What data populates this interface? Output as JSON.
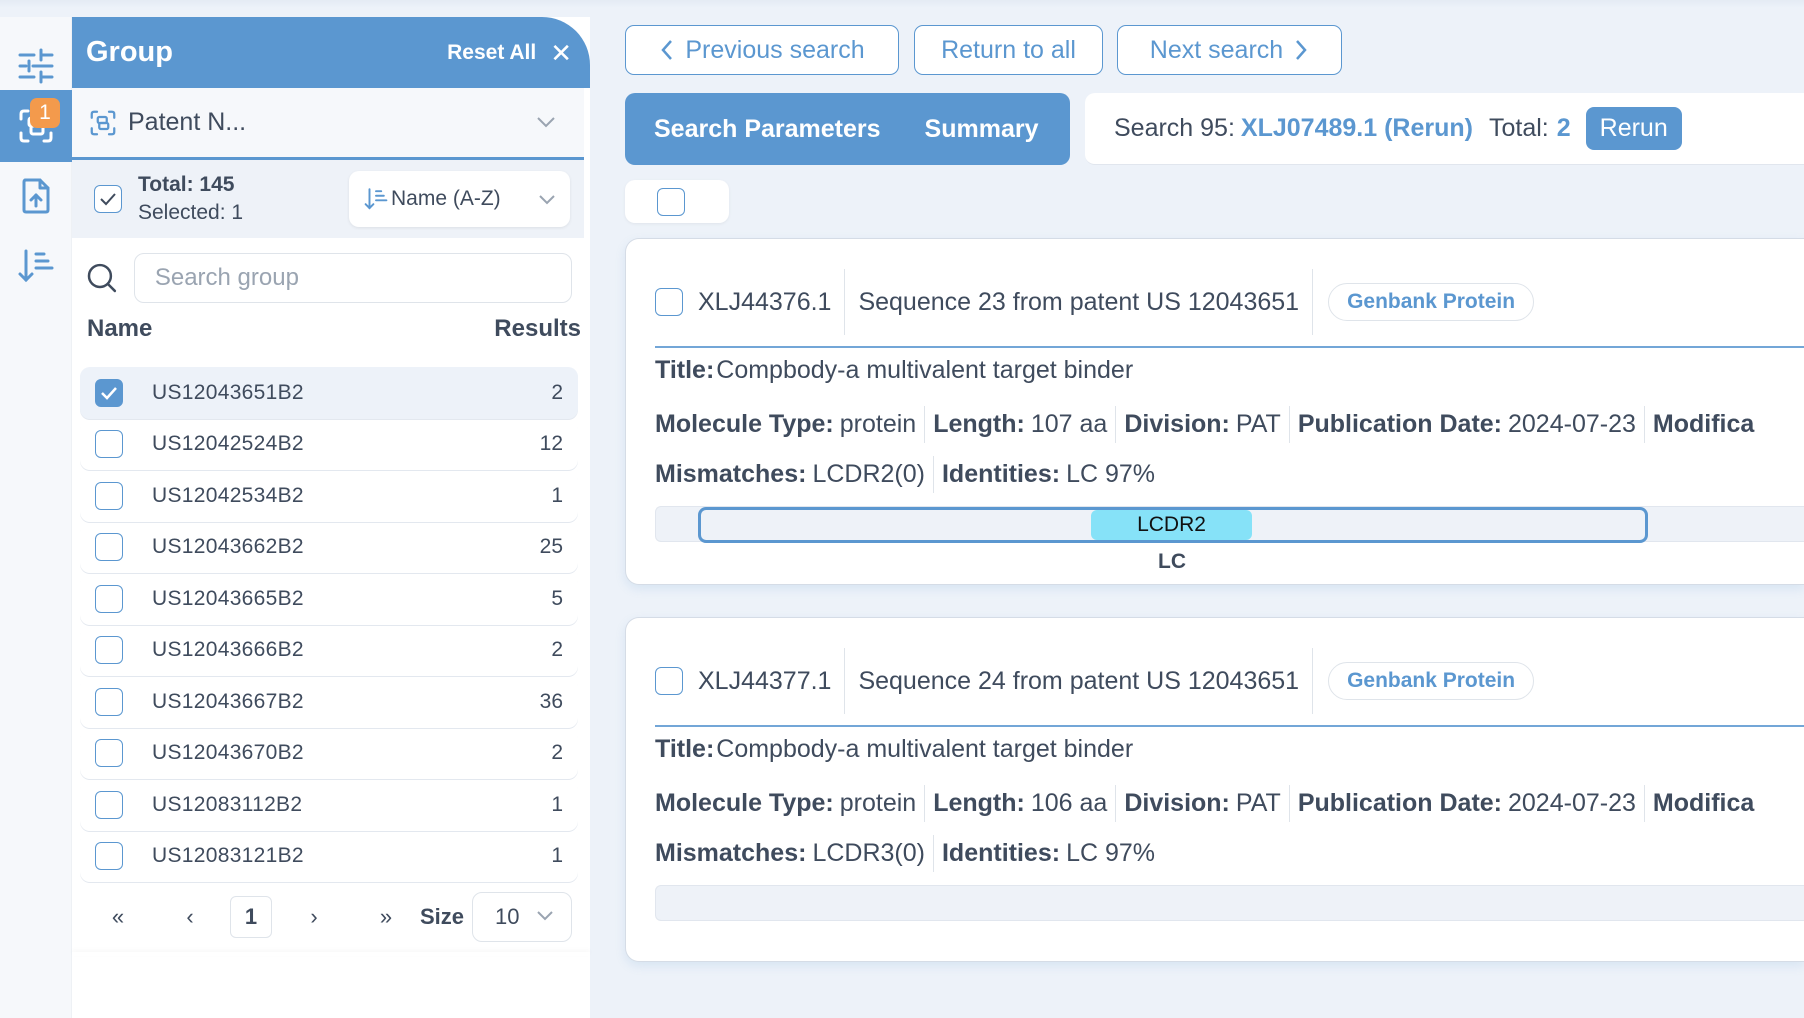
{
  "rail": {
    "items": [
      {
        "icon": "sliders-icon",
        "active": false
      },
      {
        "icon": "group-icon",
        "active": true,
        "badge": "1"
      },
      {
        "icon": "file-upload-icon",
        "active": false
      },
      {
        "icon": "sort-icon",
        "active": false
      }
    ]
  },
  "group_panel": {
    "title": "Group",
    "reset_label": "Reset All",
    "close_icon": "✕",
    "group_by": "Patent N...",
    "total_label": "Total: 145",
    "selected_label": "Selected: 1",
    "sort_label": "Name (A-Z)",
    "search_placeholder": "Search group",
    "col_name": "Name",
    "col_results": "Results",
    "rows": [
      {
        "name": "US12043651B2",
        "count": "2",
        "checked": true
      },
      {
        "name": "US12042524B2",
        "count": "12",
        "checked": false
      },
      {
        "name": "US12042534B2",
        "count": "1",
        "checked": false
      },
      {
        "name": "US12043662B2",
        "count": "25",
        "checked": false
      },
      {
        "name": "US12043665B2",
        "count": "5",
        "checked": false
      },
      {
        "name": "US12043666B2",
        "count": "2",
        "checked": false
      },
      {
        "name": "US12043667B2",
        "count": "36",
        "checked": false
      },
      {
        "name": "US12043670B2",
        "count": "2",
        "checked": false
      },
      {
        "name": "US12083112B2",
        "count": "1",
        "checked": false
      },
      {
        "name": "US12083121B2",
        "count": "1",
        "checked": false
      }
    ],
    "pager": {
      "first": "«",
      "prev": "‹",
      "current": "1",
      "next": "›",
      "last": "»",
      "size_label": "Size",
      "size_value": "10"
    }
  },
  "nav": {
    "previous": "Previous search",
    "return_all": "Return to all",
    "next": "Next search"
  },
  "tabs": {
    "params": "Search Parameters",
    "summary": "Summary"
  },
  "search_info": {
    "prefix": "Search 95:",
    "query": "XLJ07489.1 (Rerun)",
    "total_label": "Total:",
    "total_value": "2",
    "rerun_label": "Rerun"
  },
  "results": [
    {
      "accession": "XLJ44376.1",
      "description": "Sequence 23 from patent US 12043651",
      "source": "Genbank Protein",
      "title_label": "Title:",
      "title": "Compbody-a multivalent target binder",
      "meta": [
        {
          "label": "Molecule Type:",
          "value": "protein"
        },
        {
          "label": "Length:",
          "value": "107 aa"
        },
        {
          "label": "Division:",
          "value": "PAT"
        },
        {
          "label": "Publication Date:",
          "value": "2024-07-23"
        },
        {
          "label": "Modifica",
          "value": ""
        }
      ],
      "stats": [
        {
          "label": "Mismatches:",
          "value": "LCDR2(0)"
        },
        {
          "label": "Identities:",
          "value": "LC 97%"
        }
      ],
      "domain": {
        "chain": "LC",
        "region": "LCDR2"
      }
    },
    {
      "accession": "XLJ44377.1",
      "description": "Sequence 24 from patent US 12043651",
      "source": "Genbank Protein",
      "title_label": "Title:",
      "title": "Compbody-a multivalent target binder",
      "meta": [
        {
          "label": "Molecule Type:",
          "value": "protein"
        },
        {
          "label": "Length:",
          "value": "106 aa"
        },
        {
          "label": "Division:",
          "value": "PAT"
        },
        {
          "label": "Publication Date:",
          "value": "2024-07-23"
        },
        {
          "label": "Modifica",
          "value": ""
        }
      ],
      "stats": [
        {
          "label": "Mismatches:",
          "value": "LCDR3(0)"
        },
        {
          "label": "Identities:",
          "value": "LC 97%"
        }
      ]
    }
  ],
  "colors": {
    "accent": "#5b97d0",
    "badge": "#f39a4c",
    "region": "#86e2f8",
    "background": "#edf2f9"
  }
}
